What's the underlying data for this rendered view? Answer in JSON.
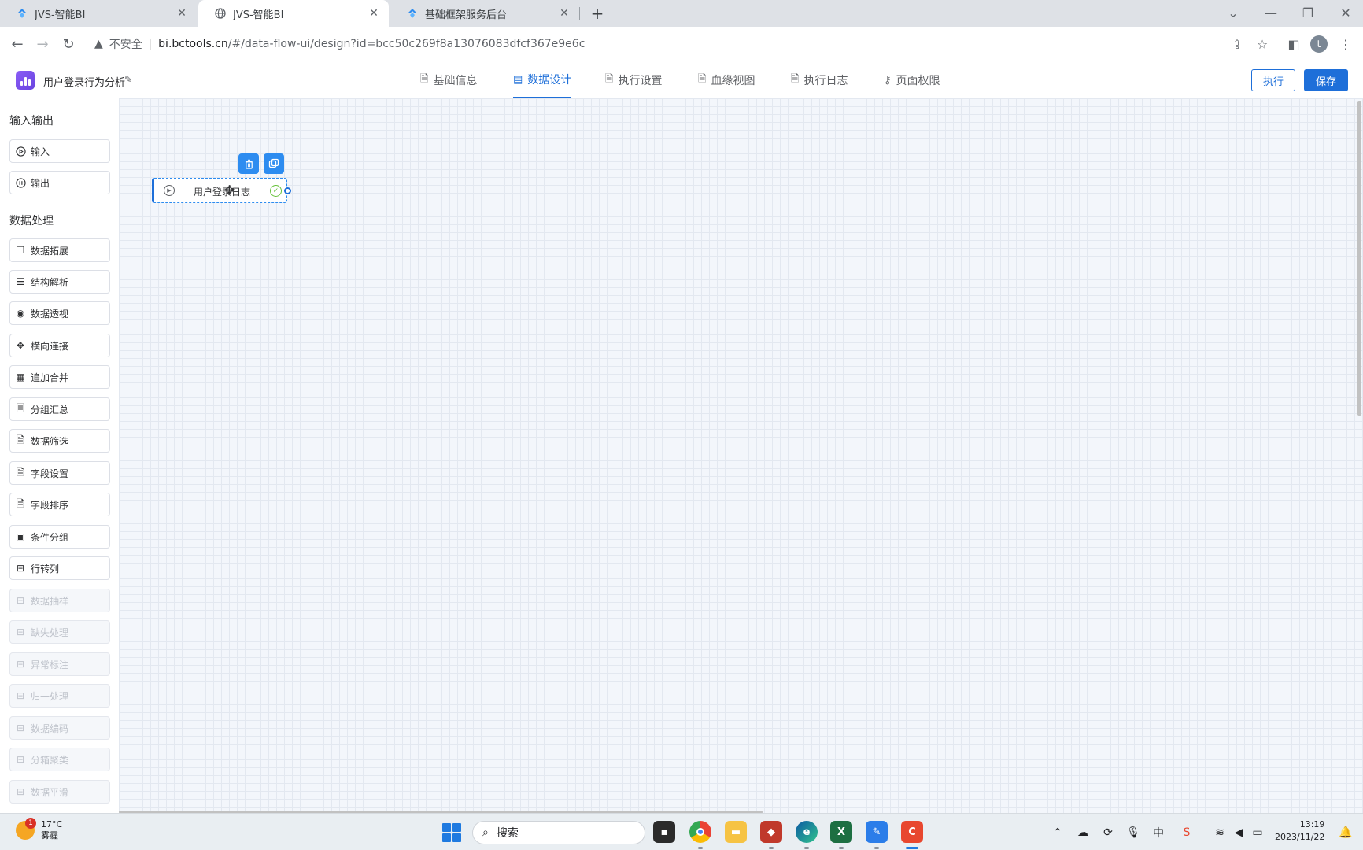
{
  "browser": {
    "tabs": [
      {
        "title": "JVS-智能BI",
        "active": false
      },
      {
        "title": "JVS-智能BI",
        "active": true
      },
      {
        "title": "基础框架服务后台",
        "active": false
      }
    ],
    "address": {
      "security_label": "不安全",
      "url_host": "bi.bctools.cn",
      "url_rest": "/#/data-flow-ui/design?id=bcc50c269f8a13076083dfcf367e9e6c"
    },
    "profile_initial": "t"
  },
  "app": {
    "name": "用户登录行为分析",
    "nav_tabs": [
      {
        "label": "基础信息",
        "icon": "document-icon",
        "active": false
      },
      {
        "label": "数据设计",
        "icon": "design-icon",
        "active": true
      },
      {
        "label": "执行设置",
        "icon": "document-icon",
        "active": false
      },
      {
        "label": "血缘视图",
        "icon": "document-icon",
        "active": false
      },
      {
        "label": "执行日志",
        "icon": "document-icon",
        "active": false
      },
      {
        "label": "页面权限",
        "icon": "key-icon",
        "active": false
      }
    ],
    "execute_label": "执行",
    "save_label": "保存",
    "accent_color": "#1e6fd9"
  },
  "sidebar": {
    "io_title": "输入输出",
    "io_items": [
      {
        "label": "输入",
        "icon": "play-circle-icon"
      },
      {
        "label": "输出",
        "icon": "pause-circle-icon"
      }
    ],
    "processing_title": "数据处理",
    "processing_items": [
      {
        "label": "数据拓展",
        "icon": "copy-icon",
        "disabled": false
      },
      {
        "label": "结构解析",
        "icon": "sliders-icon",
        "disabled": false
      },
      {
        "label": "数据透视",
        "icon": "eye-icon",
        "disabled": false
      },
      {
        "label": "横向连接",
        "icon": "move-icon",
        "disabled": false
      },
      {
        "label": "追加合并",
        "icon": "calendar-icon",
        "disabled": false
      },
      {
        "label": "分组汇总",
        "icon": "list-doc-icon",
        "disabled": false
      },
      {
        "label": "数据筛选",
        "icon": "filter-doc-icon",
        "disabled": false
      },
      {
        "label": "字段设置",
        "icon": "doc-icon",
        "disabled": false
      },
      {
        "label": "字段排序",
        "icon": "doc-icon",
        "disabled": false
      },
      {
        "label": "条件分组",
        "icon": "grid-icon",
        "disabled": false
      },
      {
        "label": "行转列",
        "icon": "stack-icon",
        "disabled": false
      },
      {
        "label": "数据抽样",
        "icon": "stack-icon",
        "disabled": true
      },
      {
        "label": "缺失处理",
        "icon": "stack-icon",
        "disabled": true
      },
      {
        "label": "异常标注",
        "icon": "stack-icon",
        "disabled": true
      },
      {
        "label": "归一处理",
        "icon": "stack-icon",
        "disabled": true
      },
      {
        "label": "数据编码",
        "icon": "stack-icon",
        "disabled": true
      },
      {
        "label": "分箱聚类",
        "icon": "stack-icon",
        "disabled": true
      },
      {
        "label": "数据平滑",
        "icon": "stack-icon",
        "disabled": true
      }
    ]
  },
  "canvas": {
    "node": {
      "label": "用户登录日志",
      "status": "ok"
    }
  },
  "taskbar": {
    "weather_temp": "17°C",
    "weather_desc": "雾霾",
    "weather_badge": "1",
    "search_placeholder": "搜索",
    "ime_label": "中",
    "time": "13:19",
    "date": "2023/11/22"
  }
}
